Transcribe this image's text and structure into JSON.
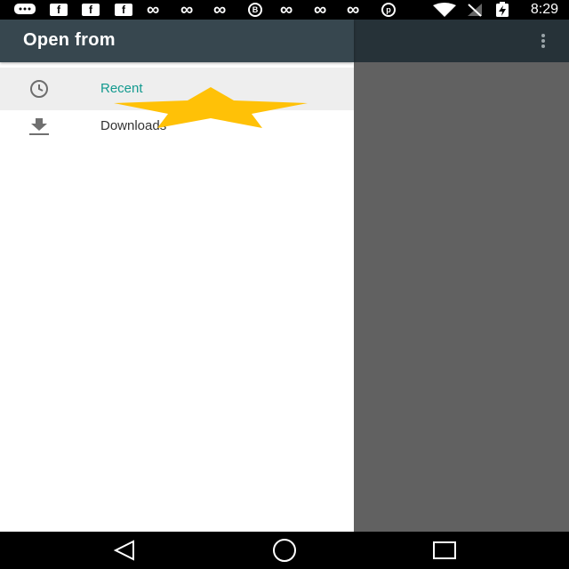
{
  "status_bar": {
    "time": "8:29",
    "left_icons": [
      "chat-bubble-icon",
      "facebook-icon",
      "facebook-icon",
      "facebook-icon",
      "infinity-icon",
      "infinity-icon",
      "infinity-icon",
      "blackberry-messenger-icon",
      "infinity-icon",
      "infinity-icon",
      "infinity-icon",
      "pinterest-icon"
    ],
    "right_icons": [
      "wifi-icon",
      "no-signal-icon",
      "battery-charging-icon"
    ],
    "facebook_glyph": "f",
    "infinity_glyph": "∞",
    "bbm_glyph": "B",
    "pinterest_glyph": "p"
  },
  "drawer": {
    "title": "Open from",
    "items": [
      {
        "label": "Recent",
        "icon": "clock-icon",
        "selected": true
      },
      {
        "label": "Downloads",
        "icon": "download-icon",
        "selected": false
      }
    ]
  },
  "nav_bar": {
    "buttons": [
      "back-button",
      "home-button",
      "recents-button"
    ]
  },
  "colors": {
    "drawer_header": "#37474f",
    "app_toolbar": "#263238",
    "selected_item_bg": "#eeeeee",
    "selected_label": "#139a8f",
    "scrim": "#616161",
    "star": "#ffc107"
  }
}
